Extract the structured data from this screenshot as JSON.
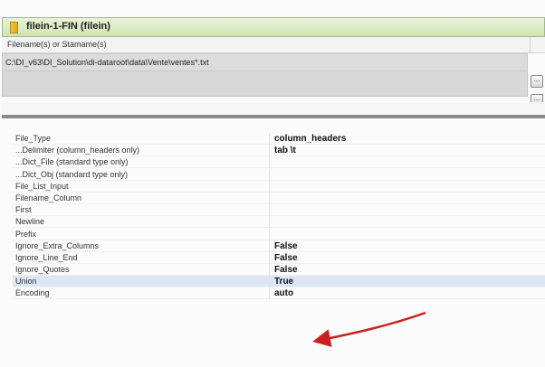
{
  "window": {
    "title": "filein-1-FIN (filein)",
    "icon": "folder-icon"
  },
  "filename_section": {
    "header_label": "Filename(s) or Stamame(s)",
    "path_value": "C:\\DI_v63\\DI_Solution\\di-dataroot\\data\\Vente\\ventes*.txt",
    "browse_button_label": "...",
    "extra_button_label": "..."
  },
  "properties": [
    {
      "name": "File_Type",
      "value": "column_headers"
    },
    {
      "name": "...Delimiter (column_headers only)",
      "value": "tab \\t"
    },
    {
      "name": "...Dict_File (standard type only)",
      "value": ""
    },
    {
      "name": "...Dict_Obj (standard type only)",
      "value": ""
    },
    {
      "name": "File_List_Input",
      "value": ""
    },
    {
      "name": "Filename_Column",
      "value": ""
    },
    {
      "name": "First",
      "value": ""
    },
    {
      "name": "Newline",
      "value": ""
    },
    {
      "name": "Prefix",
      "value": ""
    },
    {
      "name": "Ignore_Extra_Columns",
      "value": "False"
    },
    {
      "name": "Ignore_Line_End",
      "value": "False"
    },
    {
      "name": "Ignore_Quotes",
      "value": "False"
    },
    {
      "name": "Union",
      "value": "True"
    },
    {
      "name": "Encoding",
      "value": "auto"
    }
  ],
  "highlighted_property": "Union",
  "colors": {
    "title_bar": "#cfe4b4",
    "annotation_arrow": "#cc2020",
    "selection": "#dde6f3"
  }
}
